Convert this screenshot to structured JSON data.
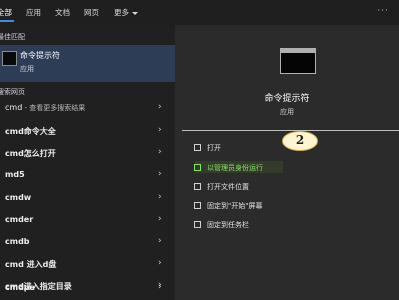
{
  "tabs": [
    {
      "label": "全部"
    },
    {
      "label": "应用"
    },
    {
      "label": "文档"
    },
    {
      "label": "网页"
    },
    {
      "label": "更多"
    }
  ],
  "more_icon": "ellipsis-icon",
  "left": {
    "best_match_label": "最佳匹配",
    "best_match": {
      "title": "命令提示符",
      "subtitle": "应用"
    },
    "web_label": "搜索网页",
    "results": [
      {
        "bold": "cmd",
        "rest": " - 查看更多搜索结果"
      },
      {
        "bold": "cmd命令大全",
        "rest": ""
      },
      {
        "bold": "cmd怎么打开",
        "rest": ""
      },
      {
        "bold": "md5",
        "rest": ""
      },
      {
        "bold": "cmdw",
        "rest": ""
      },
      {
        "bold": "cmder",
        "rest": ""
      },
      {
        "bold": "cmdb",
        "rest": ""
      },
      {
        "bold": "cmd 进入d盘",
        "rest": ""
      },
      {
        "bold": "cmd进入指定目录",
        "rest": ""
      },
      {
        "bold": "cmdpe",
        "rest": ""
      }
    ]
  },
  "right": {
    "title": "命令提示符",
    "subtitle": "应用",
    "actions": [
      {
        "label": "打开",
        "icon": "open-icon"
      },
      {
        "label": "以管理员身份运行",
        "icon": "shield-run-icon"
      },
      {
        "label": "打开文件位置",
        "icon": "folder-icon"
      },
      {
        "label": "固定到\"开始\"屏幕",
        "icon": "pin-icon"
      },
      {
        "label": "固定到任务栏",
        "icon": "pin-taskbar-icon"
      }
    ],
    "annotation_number": "2"
  },
  "colors": {
    "accent": "#3b8ee0",
    "highlight_text": "#8be36b",
    "selected_row": "#2d3d55"
  }
}
